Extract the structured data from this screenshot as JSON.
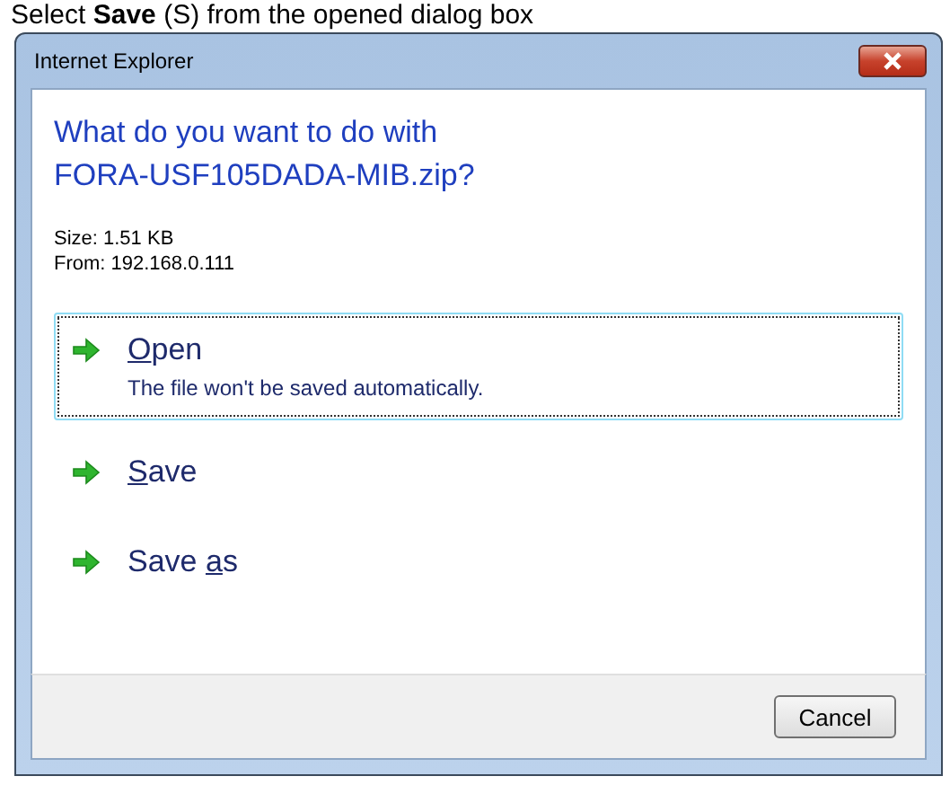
{
  "caption": "Select **Save** (S) from the opened dialog box",
  "window": {
    "title": "Internet Explorer"
  },
  "heading": [
    "What do you want to do with",
    "FORA-USF105DADA-MIB.zip?"
  ],
  "details": [
    "Size: 1.51 KB",
    "From: 192.168.0.111"
  ],
  "options": [
    {
      "key": "O",
      "after": "pen",
      "description": "The file won't be saved automatically.",
      "selected": true
    },
    {
      "key": "S",
      "after": "ave",
      "selected": false
    },
    {
      "before": "Save ",
      "key": "a",
      "after": "s",
      "selected": false
    }
  ],
  "buttons": [
    "Cancel"
  ]
}
